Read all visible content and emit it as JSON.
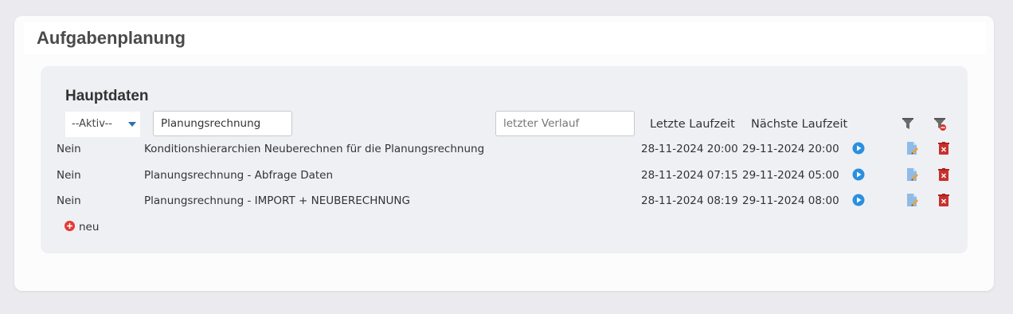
{
  "page": {
    "title": "Aufgabenplanung"
  },
  "section": {
    "title": "Hauptdaten"
  },
  "filters": {
    "active_select": "--Aktiv--",
    "name_value": "Planungsrechnung",
    "verlauf_placeholder": "letzter Verlauf"
  },
  "columns": {
    "last_run": "Letzte Laufzeit",
    "next_run": "Nächste Laufzeit"
  },
  "rows": [
    {
      "active": "Nein",
      "name": "Konditionshierarchien Neuberechnen für die Planungsrechnung",
      "last_run": "28-11-2024 20:00",
      "next_run": "29-11-2024 20:00"
    },
    {
      "active": "Nein",
      "name": "Planungsrechnung - Abfrage Daten",
      "last_run": "28-11-2024 07:15",
      "next_run": "29-11-2024 05:00"
    },
    {
      "active": "Nein",
      "name": "Planungsrechnung - IMPORT + NEUBERECHNUNG",
      "last_run": "28-11-2024 08:19",
      "next_run": "29-11-2024 08:00"
    }
  ],
  "add": {
    "label": "neu"
  },
  "icons": {
    "play": "play-icon",
    "edit": "edit-icon",
    "delete": "delete-icon",
    "filter": "filter-icon",
    "clear_filter": "clear-filter-icon",
    "add": "add-icon"
  },
  "colors": {
    "play": "#2b8fe0",
    "delete": "#c9302c",
    "add": "#e53935",
    "edit": "#6aa6de"
  }
}
